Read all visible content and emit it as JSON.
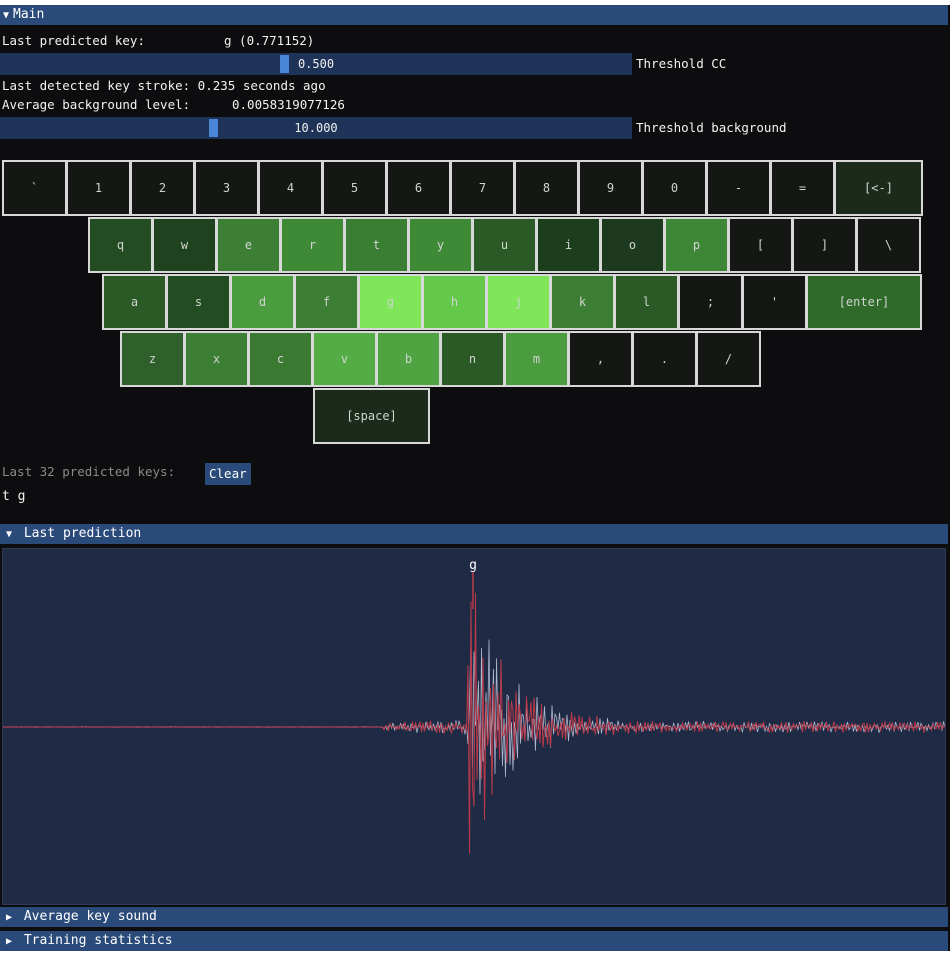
{
  "main_header": {
    "arrow": "▼",
    "title": "Main"
  },
  "last_predicted_key": {
    "label": "Last predicted key:",
    "value": "g (0.771152)"
  },
  "threshold_cc": {
    "value_text": "0.500",
    "value": 0.5,
    "label": "Threshold CC",
    "fraction": 0.45
  },
  "last_keystroke": {
    "text": "Last detected key stroke: 0.235 seconds ago"
  },
  "avg_background": {
    "label": "Average background level:",
    "value": "0.0058319077126"
  },
  "threshold_bg": {
    "value_text": "10.000",
    "value": 10.0,
    "label": "Threshold background",
    "fraction": 0.335
  },
  "keyboard": {
    "rows": [
      [
        {
          "label": "`",
          "color": "#141714"
        },
        {
          "label": "1",
          "color": "#141714"
        },
        {
          "label": "2",
          "color": "#141714"
        },
        {
          "label": "3",
          "color": "#141714"
        },
        {
          "label": "4",
          "color": "#141714"
        },
        {
          "label": "5",
          "color": "#141714"
        },
        {
          "label": "6",
          "color": "#141714"
        },
        {
          "label": "7",
          "color": "#141714"
        },
        {
          "label": "8",
          "color": "#141714"
        },
        {
          "label": "9",
          "color": "#141714"
        },
        {
          "label": "0",
          "color": "#141714"
        },
        {
          "label": "-",
          "color": "#141714"
        },
        {
          "label": "=",
          "color": "#141714"
        },
        {
          "label": "[<-]",
          "color": "#1b2a1b"
        }
      ],
      [
        {
          "label": "q",
          "color": "#234c23"
        },
        {
          "label": "w",
          "color": "#1f431f"
        },
        {
          "label": "e",
          "color": "#3c7f34"
        },
        {
          "label": "r",
          "color": "#3f8a37"
        },
        {
          "label": "t",
          "color": "#3a7e33"
        },
        {
          "label": "y",
          "color": "#3f8a37"
        },
        {
          "label": "u",
          "color": "#2b5a27"
        },
        {
          "label": "i",
          "color": "#1d3e1d"
        },
        {
          "label": "o",
          "color": "#1e3a1e"
        },
        {
          "label": "p",
          "color": "#3e8737"
        },
        {
          "label": "[",
          "color": "#141714"
        },
        {
          "label": "]",
          "color": "#141714"
        },
        {
          "label": "\\",
          "color": "#141714"
        }
      ],
      [
        {
          "label": "a",
          "color": "#2b5a27"
        },
        {
          "label": "s",
          "color": "#234c23"
        },
        {
          "label": "d",
          "color": "#4b9c3f"
        },
        {
          "label": "f",
          "color": "#3c7f34"
        },
        {
          "label": "g",
          "color": "#7fe65a"
        },
        {
          "label": "h",
          "color": "#64c84a"
        },
        {
          "label": "j",
          "color": "#7fe65a"
        },
        {
          "label": "k",
          "color": "#3c7f34"
        },
        {
          "label": "l",
          "color": "#2b5a27"
        },
        {
          "label": ";",
          "color": "#141714"
        },
        {
          "label": "'",
          "color": "#141714"
        },
        {
          "label": "[enter]",
          "color": "#2f6a2b"
        }
      ],
      [
        {
          "label": "z",
          "color": "#2f5f2b"
        },
        {
          "label": "x",
          "color": "#3c7f34"
        },
        {
          "label": "c",
          "color": "#3a7a33"
        },
        {
          "label": "v",
          "color": "#54ad44"
        },
        {
          "label": "b",
          "color": "#4fa441"
        },
        {
          "label": "n",
          "color": "#2b5a27"
        },
        {
          "label": "m",
          "color": "#4b9c3f"
        },
        {
          "label": ",",
          "color": "#141714"
        },
        {
          "label": ".",
          "color": "#141714"
        },
        {
          "label": "/",
          "color": "#141714"
        }
      ],
      [
        {
          "label": "[space]",
          "color": "#1b2a1b"
        }
      ]
    ]
  },
  "last32": {
    "label": "Last 32 predicted keys:",
    "clear_label": "Clear",
    "history": "t g"
  },
  "last_prediction_header": {
    "arrow": "▼",
    "title": "Last prediction"
  },
  "waveform": {
    "marker_label": "g",
    "colors": {
      "primary": "#b83a4a",
      "secondary": "#c8d2e6",
      "background": "#1f2a45"
    }
  },
  "avg_key_sound_header": {
    "arrow": "▶",
    "title": "Average key sound"
  },
  "training_stats_header": {
    "arrow": "▶",
    "title": "Training statistics"
  }
}
